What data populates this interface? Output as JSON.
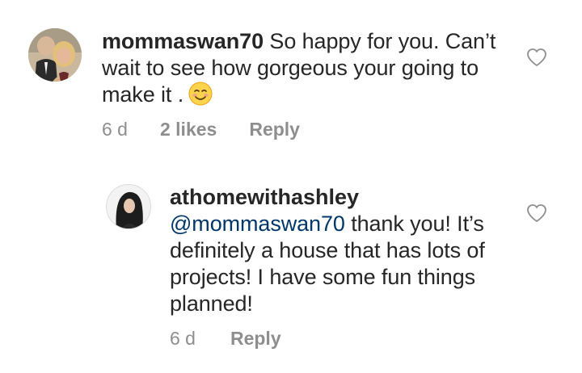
{
  "comments": [
    {
      "username": "mommaswan70",
      "text": "So happy for you. Can’t wait to see how gorgeous your going to make it .",
      "emoji": "smiling-face-icon",
      "time": "6 d",
      "likes": "2 likes",
      "reply_label": "Reply"
    },
    {
      "username": "athomewithashley",
      "mention": "@mommaswan70",
      "text": "thank you! It’s definitely a house that has lots of projects! I have some fun things planned!",
      "time": "6 d",
      "reply_label": "Reply"
    }
  ],
  "colors": {
    "text": "#262626",
    "muted": "#8e8e8e",
    "mention": "#00376b"
  }
}
